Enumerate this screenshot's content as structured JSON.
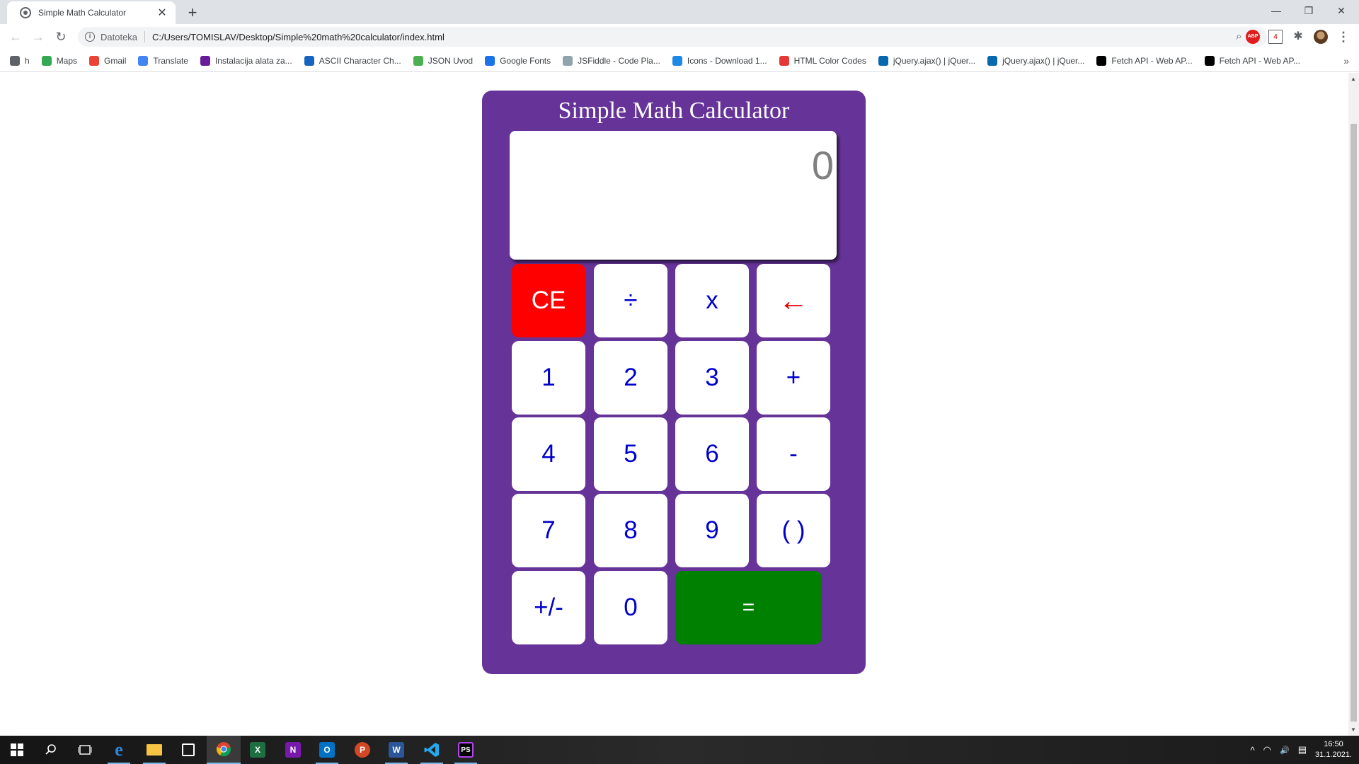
{
  "browser": {
    "tab_title": "Simple Math Calculator",
    "tab_close": "✕",
    "new_tab": "+",
    "window_controls": {
      "minimize": "—",
      "restore": "❐",
      "close": "✕"
    },
    "nav": {
      "back": "←",
      "forward": "→",
      "reload": "↻"
    },
    "address": {
      "info_icon": "i",
      "scheme_label": "Datoteka",
      "url": "C:/Users/TOMISLAV/Desktop/Simple%20math%20calculator/index.html"
    },
    "omnibox_icons": {
      "zoom": "⌕",
      "star": "☆"
    },
    "extensions": {
      "abp": "ABP",
      "calendar": "4",
      "puzzle": "✱",
      "menu": "⋮"
    },
    "bookmarks": [
      {
        "label": "h",
        "icon": "globe-icon",
        "color": "#5f6368"
      },
      {
        "label": "Maps",
        "icon": "maps-icon",
        "color": "#34a853"
      },
      {
        "label": "Gmail",
        "icon": "gmail-icon",
        "color": "#ea4335"
      },
      {
        "label": "Translate",
        "icon": "translate-icon",
        "color": "#4285f4"
      },
      {
        "label": "Instalacija alata za...",
        "icon": "wp-icon",
        "color": "#6a1b9a"
      },
      {
        "label": "ASCII Character Ch...",
        "icon": "ascii-icon",
        "color": "#1565c0"
      },
      {
        "label": "JSON Uvod",
        "icon": "w3-icon",
        "color": "#4caf50"
      },
      {
        "label": "Google Fonts",
        "icon": "fonts-icon",
        "color": "#1a73e8"
      },
      {
        "label": "JSFiddle - Code Pla...",
        "icon": "jsfiddle-icon",
        "color": "#90a4ae"
      },
      {
        "label": "Icons - Download 1...",
        "icon": "icons8-icon",
        "color": "#1e88e5"
      },
      {
        "label": "HTML Color Codes",
        "icon": "color-icon",
        "color": "#e53935"
      },
      {
        "label": "jQuery.ajax() | jQuer...",
        "icon": "jquery-icon",
        "color": "#0769ad"
      },
      {
        "label": "jQuery.ajax() | jQuer...",
        "icon": "jquery-icon",
        "color": "#0769ad"
      },
      {
        "label": "Fetch API - Web AP...",
        "icon": "mdn-icon",
        "color": "#000000"
      },
      {
        "label": "Fetch API - Web AP...",
        "icon": "mdn-icon",
        "color": "#000000"
      }
    ],
    "bookmarks_more": "»"
  },
  "calculator": {
    "title": "Simple Math Calculator",
    "display_value": "0",
    "keys": {
      "ce": "CE",
      "divide": "÷",
      "multiply": "x",
      "backspace": "←",
      "one": "1",
      "two": "2",
      "three": "3",
      "plus": "+",
      "four": "4",
      "five": "5",
      "six": "6",
      "minus": "-",
      "seven": "7",
      "eight": "8",
      "nine": "9",
      "parens": "( )",
      "negate": "+/-",
      "zero": "0",
      "equals": "="
    },
    "colors": {
      "panel": "#663399",
      "ce": "#ff0000",
      "equals": "#008000",
      "digits": "#0000cc",
      "backspace": "#e00000"
    }
  },
  "taskbar": {
    "apps": [
      "start-icon",
      "search-icon",
      "task-view-icon",
      "edge-icon",
      "file-explorer-icon",
      "store-icon",
      "chrome-icon",
      "excel-icon",
      "onenote-icon",
      "outlook-icon",
      "powerpoint-icon",
      "word-icon",
      "vscode-icon",
      "phpstorm-icon"
    ],
    "labels": {
      "excel": "X",
      "onenote": "N",
      "outlook": "O",
      "powerpoint": "P",
      "word": "W",
      "phpstorm": "PS",
      "edge": "e"
    },
    "tray": {
      "chevron": "^",
      "network": "◠",
      "volume": "🔊",
      "notifications": "▤"
    },
    "time": "16:50",
    "date": "31.1.2021."
  }
}
